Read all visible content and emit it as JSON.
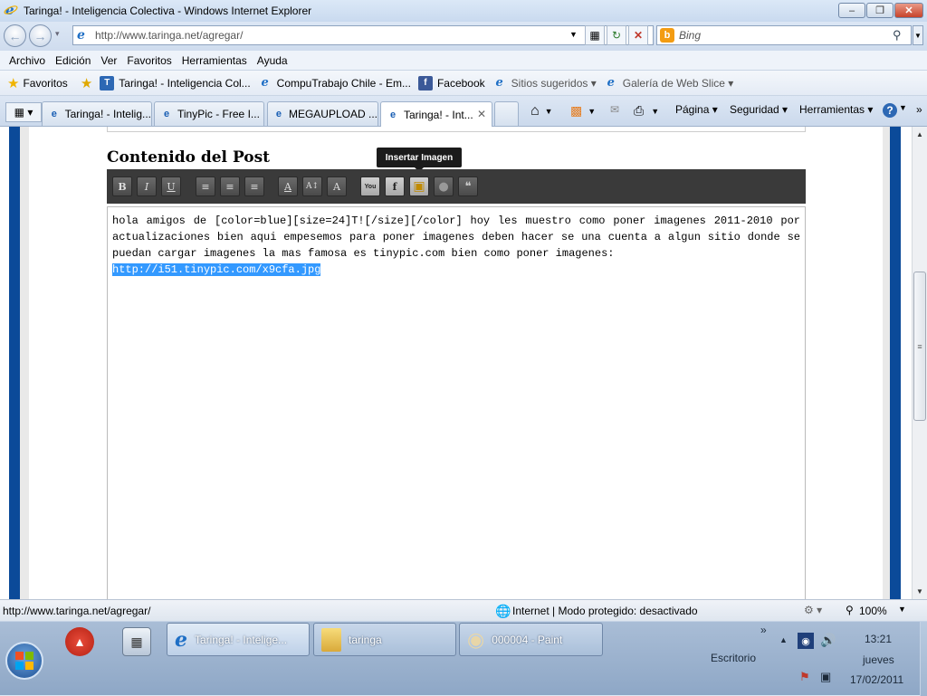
{
  "window": {
    "title": "Taringa! - Inteligencia Colectiva - Windows Internet Explorer",
    "minimize": "–",
    "maximize": "❐",
    "close": "✕"
  },
  "address_bar": {
    "url": "http://www.taringa.net/agregar/",
    "search_placeholder": "Bing"
  },
  "menu": [
    "Archivo",
    "Edición",
    "Ver",
    "Favoritos",
    "Herramientas",
    "Ayuda"
  ],
  "favorites_bar": {
    "favorites_label": "Favoritos",
    "items": [
      {
        "label": "Taringa! - Inteligencia Col...",
        "icon": "T"
      },
      {
        "label": "CompuTrabajo Chile - Em...",
        "icon": "e"
      },
      {
        "label": "Facebook",
        "icon": "f"
      },
      {
        "label": "Sitios sugeridos ▾",
        "icon": "e"
      },
      {
        "label": "Galería de Web Slice ▾",
        "icon": "e"
      }
    ]
  },
  "tabs": [
    {
      "label": "Taringa! - Intelig...",
      "active": false
    },
    {
      "label": "TinyPic - Free I...",
      "active": false
    },
    {
      "label": "MEGAUPLOAD ...",
      "active": false
    },
    {
      "label": "Taringa! - Int...",
      "active": true
    }
  ],
  "command_bar": {
    "page": "Página ▾",
    "safety": "Seguridad ▾",
    "tools": "Herramientas ▾",
    "help": "?"
  },
  "editor": {
    "heading": "Contenido del Post",
    "tooltip": "Insertar Imagen",
    "toolbar_buttons": [
      {
        "name": "bold",
        "label": "B"
      },
      {
        "name": "italic",
        "label": "I"
      },
      {
        "name": "underline",
        "label": "U"
      },
      {
        "name": "align-left",
        "label": "≡"
      },
      {
        "name": "align-center",
        "label": "≡"
      },
      {
        "name": "align-right",
        "label": "≡"
      },
      {
        "name": "font-color",
        "label": "A"
      },
      {
        "name": "font-size",
        "label": "A↕"
      },
      {
        "name": "font-face",
        "label": "A"
      },
      {
        "name": "youtube",
        "label": "You"
      },
      {
        "name": "flash",
        "label": "f"
      },
      {
        "name": "insert-image",
        "label": "▣"
      },
      {
        "name": "circle",
        "label": "●"
      },
      {
        "name": "quote",
        "label": "❝"
      }
    ],
    "body_text": "hola amigos de [color=blue][size=24]T![/size][/color] hoy les muestro como poner imagenes 2011-2010 por actualizaciones bien aqui empesemos para poner imagenes deben hacer se una cuenta a algun sitio donde se puedan cargar imagenes la mas famosa es tinypic.com bien como poner imagenes:",
    "selected_text": "http://i51.tinypic.com/x9cfa.jpg"
  },
  "status_bar": {
    "url": "http://www.taringa.net/agregar/",
    "zone": "Internet | Modo protegido: desactivado",
    "zoom": "100%"
  },
  "taskbar": {
    "buttons": [
      {
        "label": "Taringa! - Intelige...",
        "active": true
      },
      {
        "label": "taringa",
        "active": false
      },
      {
        "label": "000004 - Paint",
        "active": false
      }
    ],
    "desktop_label": "Escritorio",
    "clock": {
      "time": "13:21",
      "day": "jueves",
      "date": "17/02/2011"
    }
  }
}
